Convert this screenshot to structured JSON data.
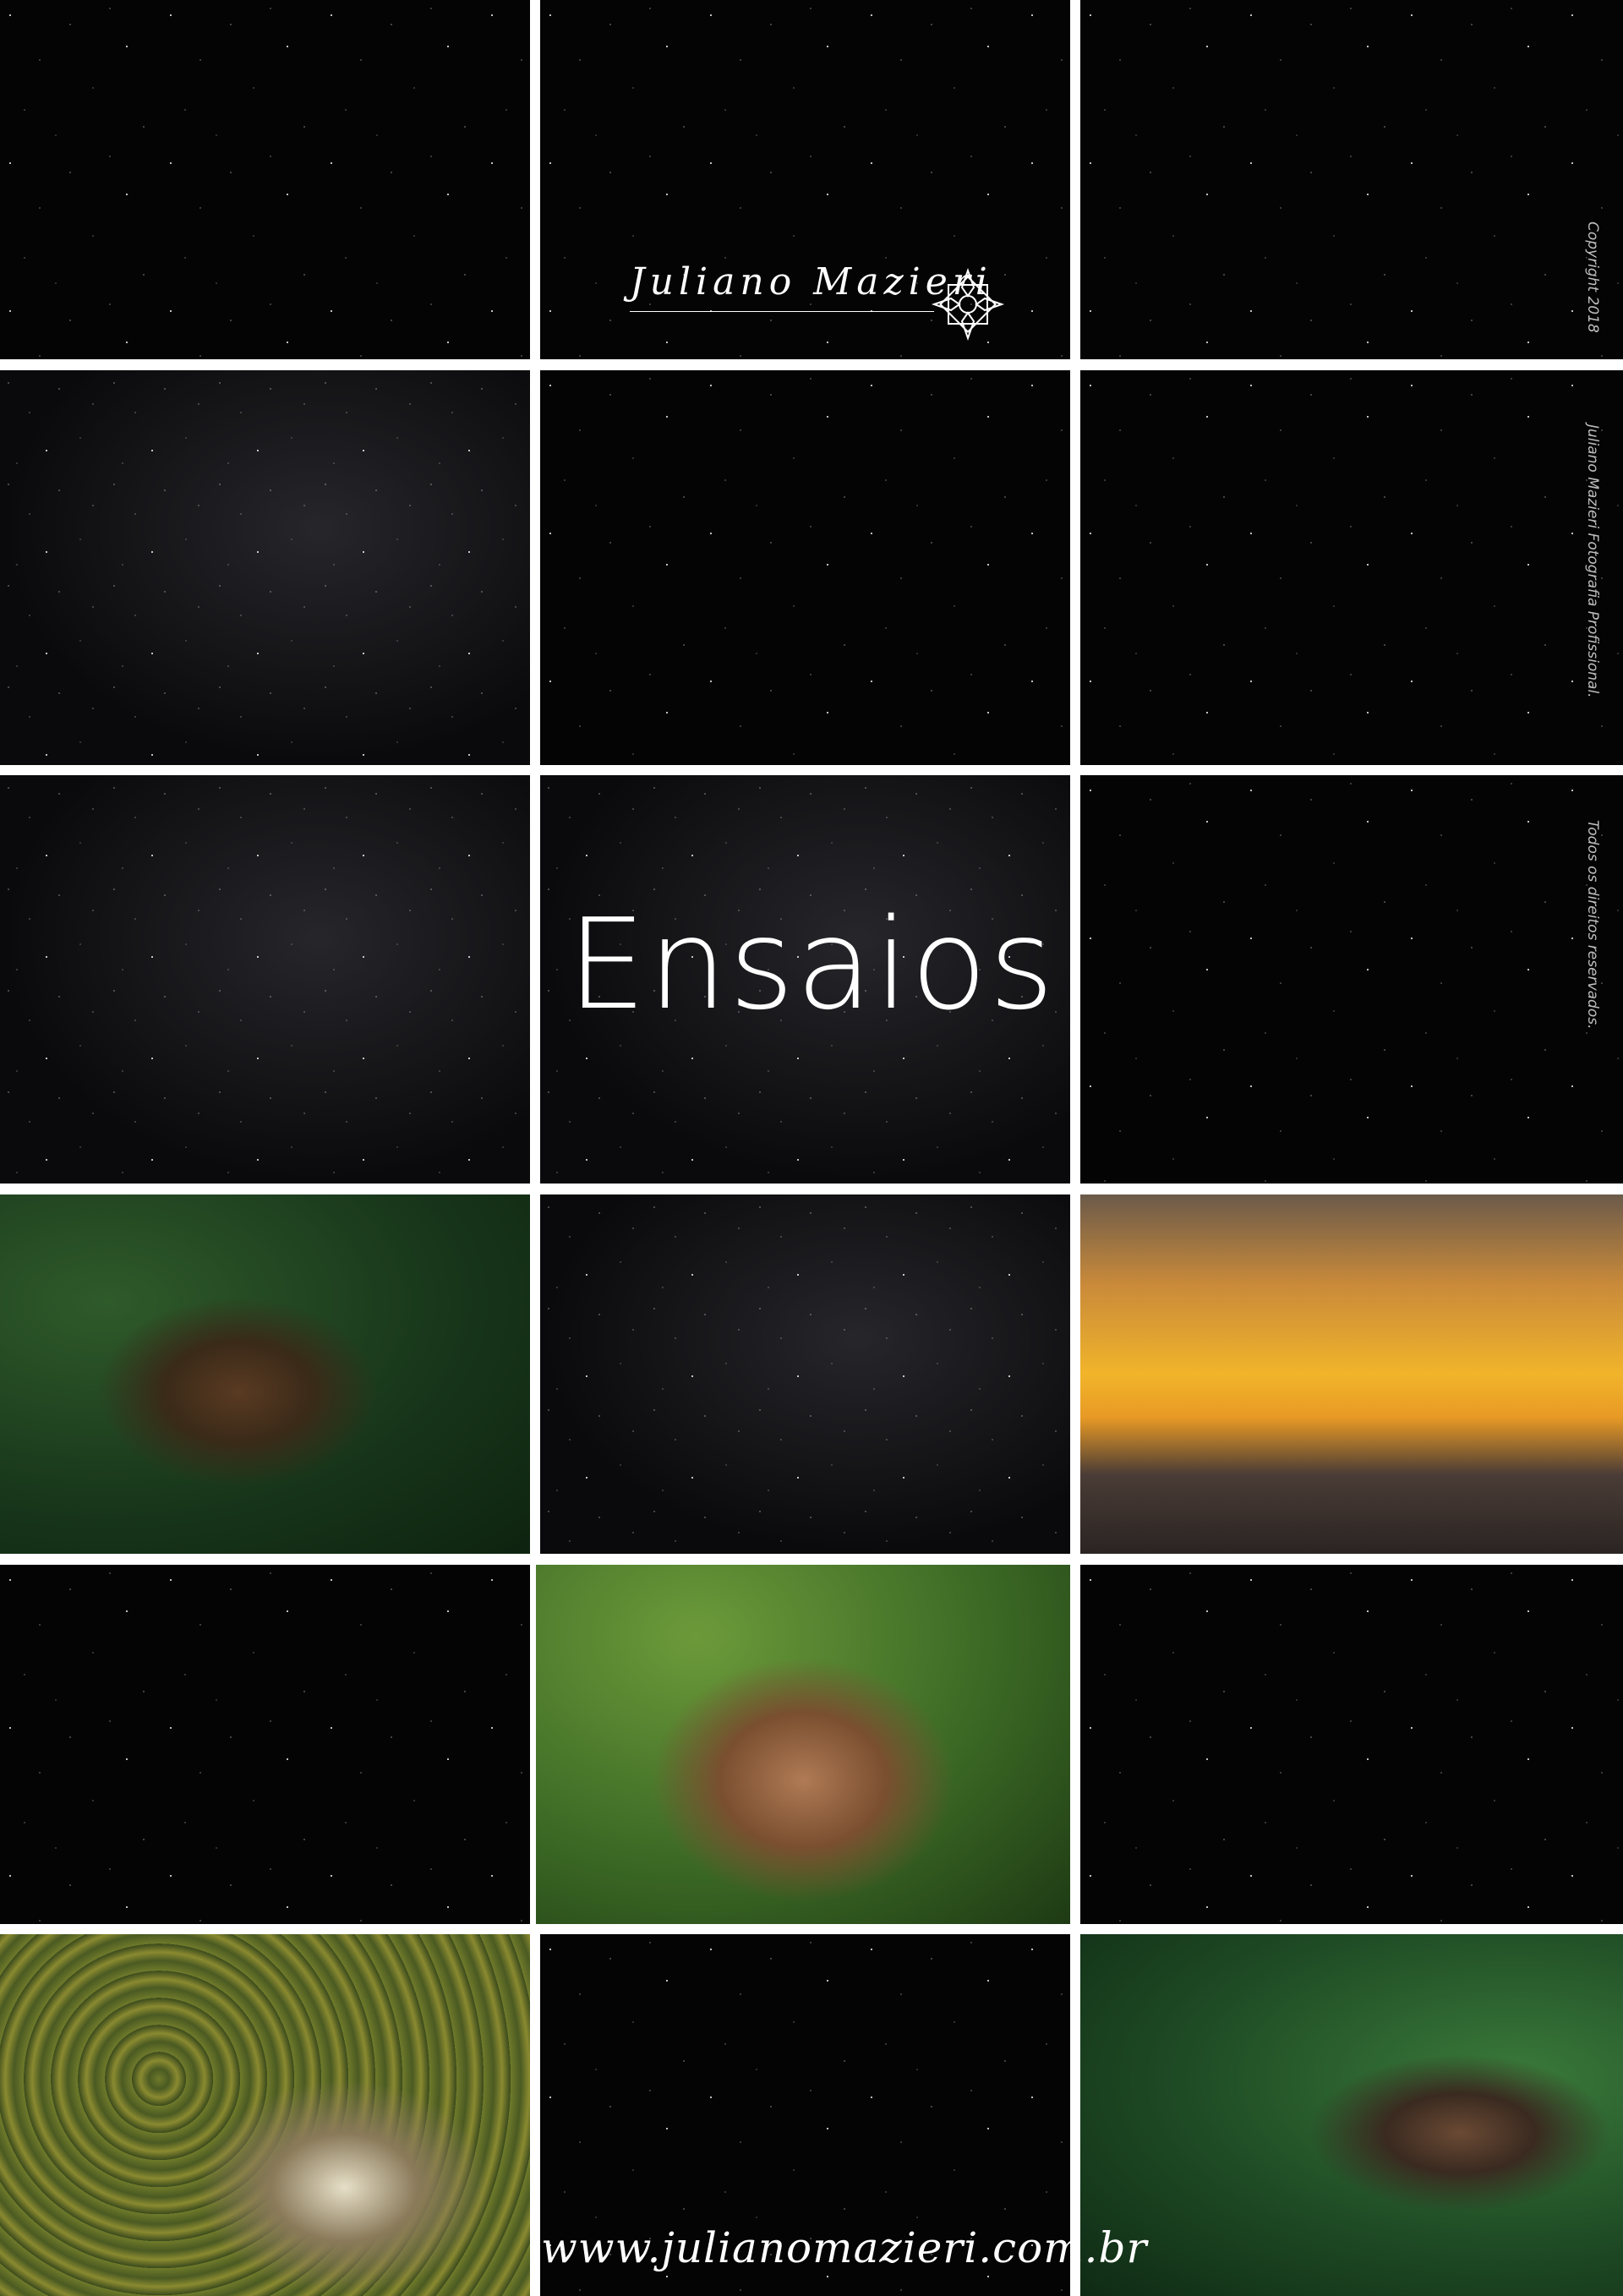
{
  "brand": {
    "logo_text": "Juliano Mazieri"
  },
  "title": "Ensaios",
  "side_texts": {
    "copyright": "Copyright 2018",
    "company": "Juliano Mazieri Fotografia Profissional.",
    "rights": "Todos os direitos reservados."
  },
  "footer": {
    "url": "www.julianomazieri.com.br"
  },
  "colors": {
    "background": "#000000",
    "gutter": "#ffffff",
    "text": "#ffffff"
  }
}
